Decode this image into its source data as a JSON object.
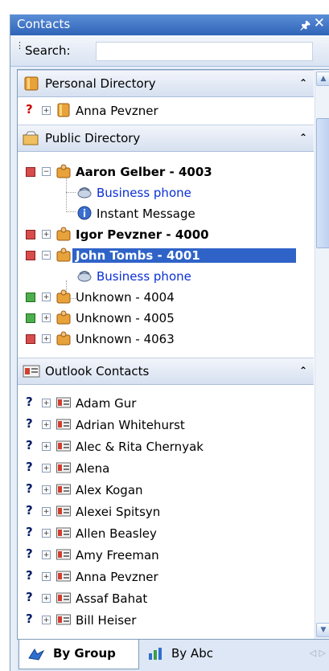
{
  "panel": {
    "title": "Contacts",
    "pin_glyph": "↕",
    "close_glyph": "✕"
  },
  "search": {
    "label": "Search:",
    "value": "",
    "underline_char": "S"
  },
  "sections": {
    "personal": {
      "title": "Personal Directory",
      "contacts": [
        {
          "status": "?",
          "name": "Anna Pevzner"
        }
      ]
    },
    "public": {
      "title": "Public Directory",
      "contacts": [
        {
          "status": "red",
          "name": "Aaron Gelber - 4003",
          "expanded": true,
          "children": [
            "Business phone",
            "Instant Message"
          ]
        },
        {
          "status": "red",
          "name": "Igor Pevzner - 4000",
          "expanded": false
        },
        {
          "status": "red",
          "name": "John Tombs - 4001",
          "expanded": true,
          "selected": true,
          "children": [
            "Business phone"
          ]
        },
        {
          "status": "green",
          "name": "Unknown - 4004"
        },
        {
          "status": "green",
          "name": "Unknown - 4005"
        },
        {
          "status": "red",
          "name": "Unknown - 4063"
        }
      ]
    },
    "outlook": {
      "title": "Outlook Contacts",
      "contacts": [
        "Adam Gur",
        "Adrian Whitehurst",
        "Alec & Rita Chernyak",
        "Alena",
        "Alex Kogan",
        "Alexei Spitsyn",
        "Allen Beasley",
        "Amy Freeman",
        "Anna Pevzner",
        "Assaf Bahat",
        "Bill Heiser"
      ]
    }
  },
  "tabs": {
    "by_group": "By Group",
    "by_abc": "By Abc"
  },
  "glyphs": {
    "collapse": "»",
    "plus": "+",
    "minus": "−",
    "question": "?"
  },
  "colors": {
    "accent": "#2f63c8",
    "link": "#0a2fd4",
    "status_red": "#d84c4c",
    "status_green": "#4cae4c"
  }
}
